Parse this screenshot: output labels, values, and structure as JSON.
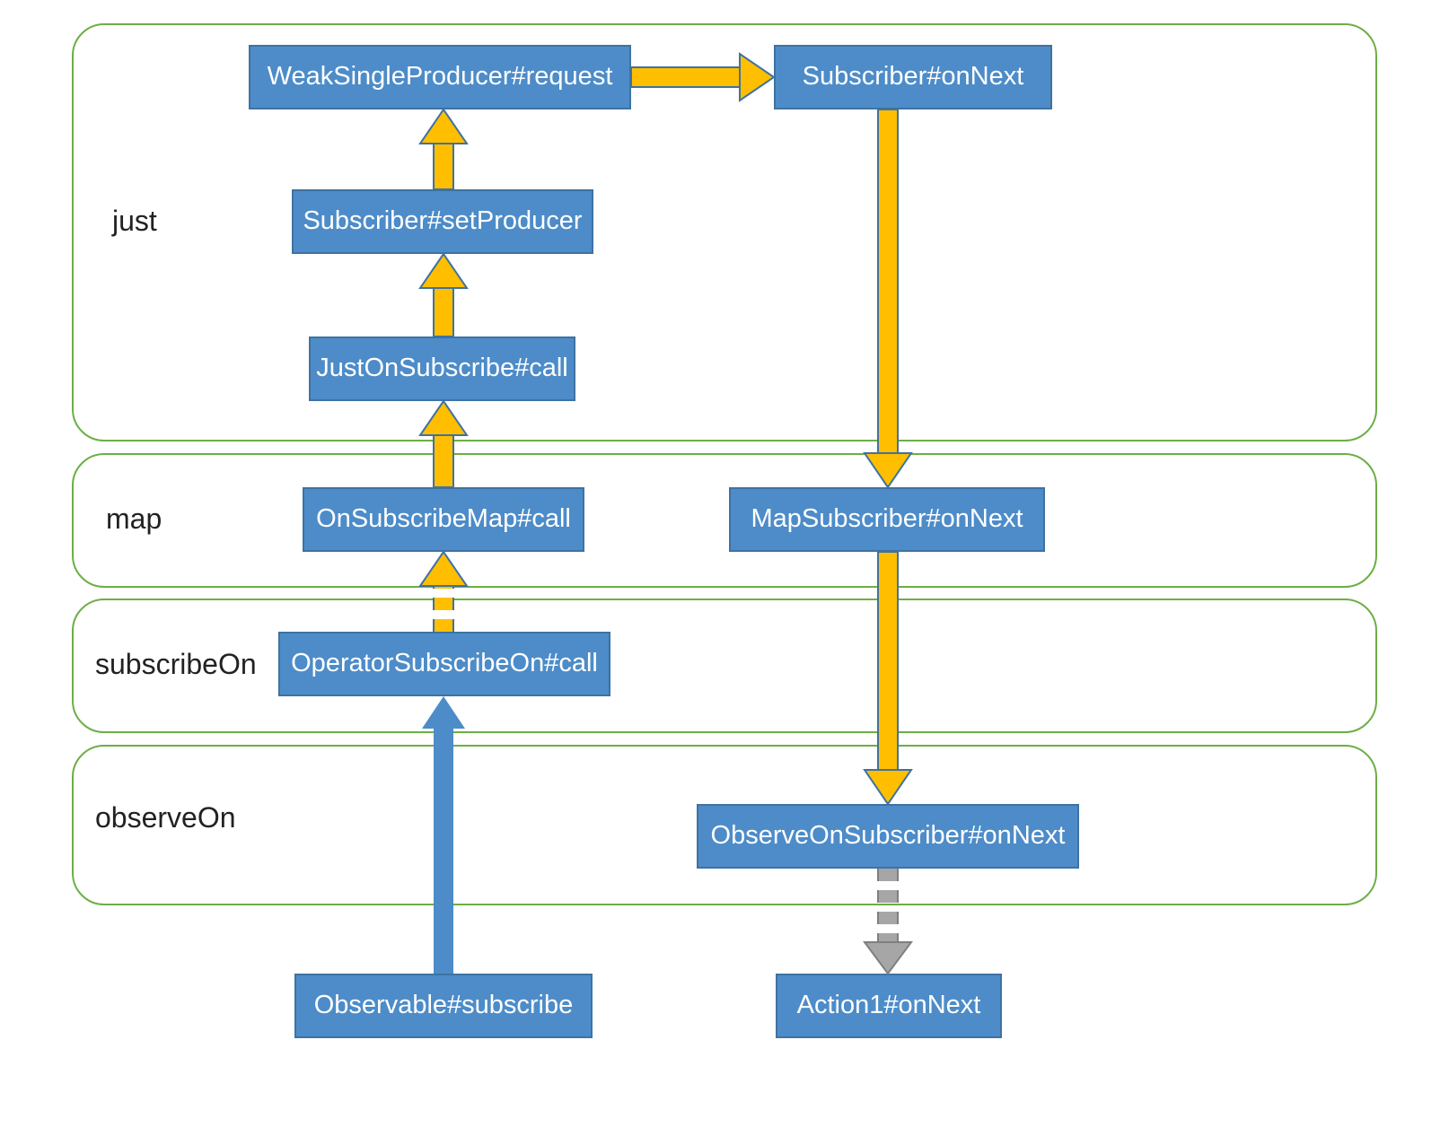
{
  "regions": {
    "just": {
      "label": "just"
    },
    "map": {
      "label": "map"
    },
    "subscribeOn": {
      "label": "subscribeOn"
    },
    "observeOn": {
      "label": "observeOn"
    }
  },
  "nodes": {
    "weakSingleProducerRequest": "WeakSingleProducer#request",
    "subscriberOnNext": "Subscriber#onNext",
    "subscriberSetProducer": "Subscriber#setProducer",
    "justOnSubscribeCall": "JustOnSubscribe#call",
    "onSubscribeMapCall": "OnSubscribeMap#call",
    "mapSubscriberOnNext": "MapSubscriber#onNext",
    "operatorSubscribeOnCall": "OperatorSubscribeOn#call",
    "observeOnSubscriberOnNext": "ObserveOnSubscriber#onNext",
    "observableSubscribe": "Observable#subscribe",
    "action1OnNext": "Action1#onNext"
  },
  "colors": {
    "nodeFill": "#4D8CC8",
    "nodeStroke": "#3F72A1",
    "regionStroke": "#6DAE44",
    "arrowBlue": "#4D8CC8",
    "arrowYellowFill": "#FFBF00",
    "arrowYellowStroke": "#3F72A1",
    "arrowGreyFill": "#A6A6A6",
    "arrowGreyStroke": "#7F7F7F"
  },
  "edges": [
    {
      "from": "observableSubscribe",
      "to": "operatorSubscribeOnCall",
      "style": "blue-solid",
      "dir": "up"
    },
    {
      "from": "operatorSubscribeOnCall",
      "to": "onSubscribeMapCall",
      "style": "yellow-dashed",
      "dir": "up"
    },
    {
      "from": "onSubscribeMapCall",
      "to": "justOnSubscribeCall",
      "style": "yellow-solid",
      "dir": "up"
    },
    {
      "from": "justOnSubscribeCall",
      "to": "subscriberSetProducer",
      "style": "yellow-solid",
      "dir": "up"
    },
    {
      "from": "subscriberSetProducer",
      "to": "weakSingleProducerRequest",
      "style": "yellow-solid",
      "dir": "up"
    },
    {
      "from": "weakSingleProducerRequest",
      "to": "subscriberOnNext",
      "style": "yellow-solid",
      "dir": "right"
    },
    {
      "from": "subscriberOnNext",
      "to": "mapSubscriberOnNext",
      "style": "yellow-solid",
      "dir": "down"
    },
    {
      "from": "mapSubscriberOnNext",
      "to": "observeOnSubscriberOnNext",
      "style": "yellow-solid",
      "dir": "down"
    },
    {
      "from": "observeOnSubscriberOnNext",
      "to": "action1OnNext",
      "style": "grey-dashed",
      "dir": "down"
    }
  ]
}
